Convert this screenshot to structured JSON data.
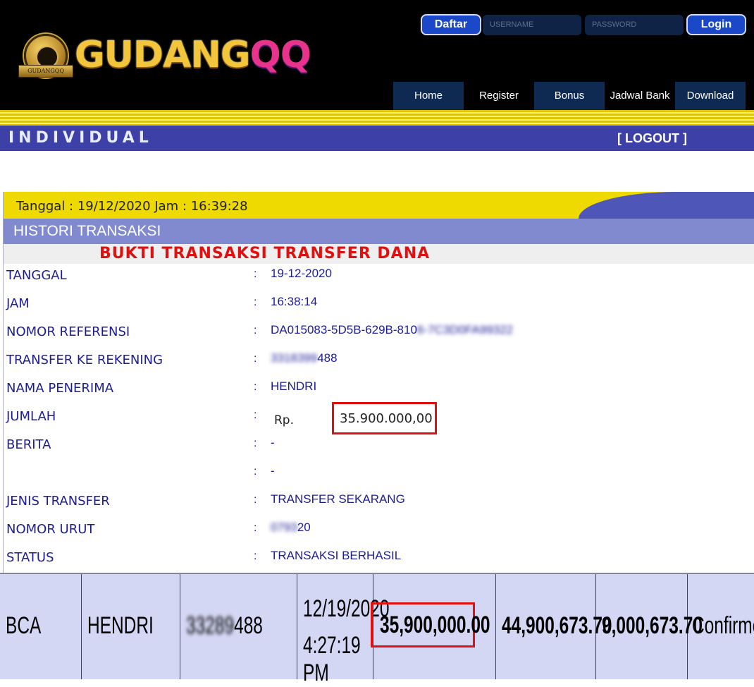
{
  "header": {
    "brand_main": "GUDANG",
    "brand_accent": "QQ",
    "brand_ribbon": "GUDANGQQ",
    "daftar_label": "Daftar",
    "username_placeholder": "USERNAME",
    "password_placeholder": "PASSWORD",
    "login_label": "Login",
    "nav": [
      "Home",
      "Register",
      "Bonus",
      "Jadwal Bank",
      "Download"
    ]
  },
  "banner": {
    "title": "INDIVIDUAL",
    "logout_label": "[ LOGOUT ]"
  },
  "date_line": "Tanggal : 19/12/2020 Jam : 16:39:28",
  "history_title": "HISTORI TRANSAKSI",
  "proof_title": "BUKTI TRANSAKSI TRANSFER DANA",
  "details": {
    "tanggal": {
      "label": "TANGGAL",
      "value": "19-12-2020"
    },
    "jam": {
      "label": "JAM",
      "value": "16:38:14"
    },
    "nomor_referensi": {
      "label": "NOMOR REFERENSI",
      "value_visible": "DA015083-5D5B-629B-810",
      "value_blurred": "6-7C3D0FA99322"
    },
    "transfer_ke_rekening": {
      "label": "TRANSFER KE REKENING",
      "value_blurred": "3318399",
      "value_visible": "488"
    },
    "nama_penerima": {
      "label": "NAMA PENERIMA",
      "value": "HENDRI"
    },
    "jumlah": {
      "label": "JUMLAH",
      "currency": "Rp.",
      "value": "35.900.000,00"
    },
    "berita": {
      "label": "BERITA",
      "value": "-"
    },
    "berita2": {
      "label": "",
      "value": "-"
    },
    "jenis_transfer": {
      "label": "JENIS TRANSFER",
      "value": "TRANSFER SEKARANG"
    },
    "nomor_urut": {
      "label": "NOMOR URUT",
      "value_blurred": "0793",
      "value_visible": "20"
    },
    "status": {
      "label": "STATUS",
      "value": "TRANSAKSI BERHASIL"
    },
    "colon": ":"
  },
  "bottom_row": {
    "bank": "BCA",
    "name": "HENDRI",
    "account_blurred": "33289",
    "account_visible": "488",
    "date": "12/19/2020",
    "time": "4:27:19 PM",
    "amount": "35,900,000.00",
    "balance_after": "44,900,673.70",
    "balance_before": "9,000,673.70",
    "status": "Confirmed"
  }
}
